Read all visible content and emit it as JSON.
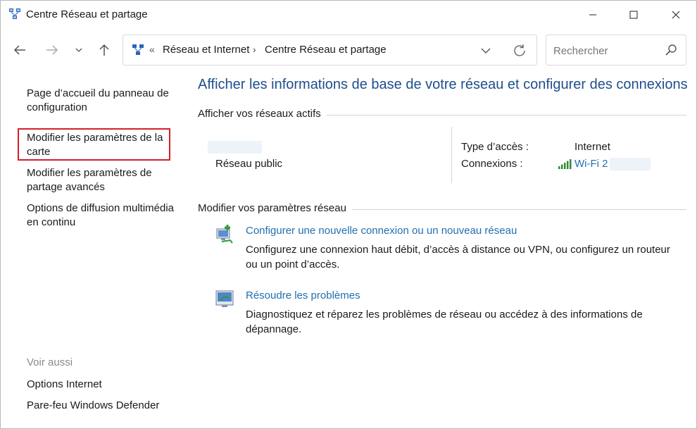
{
  "window": {
    "title": "Centre Réseau et partage"
  },
  "nav": {
    "breadcrumb_prefix": "«",
    "crumbs": [
      "Réseau et Internet",
      "Centre Réseau et partage"
    ],
    "search_placeholder": "Rechercher"
  },
  "sidebar": {
    "links": [
      "Page d’accueil du panneau de configuration",
      "Modifier les paramètres de la carte",
      "Modifier les paramètres de partage avancés",
      "Options de diffusion multimédia en continu"
    ],
    "see_also_heading": "Voir aussi",
    "see_also": [
      "Options Internet",
      "Pare-feu Windows Defender"
    ]
  },
  "main": {
    "title": "Afficher les informations de base de votre réseau et configurer des connexions",
    "active_networks_heading": "Afficher vos réseaux actifs",
    "network_type": "Réseau public",
    "access_type_label": "Type d’accès :",
    "access_type_value": "Internet",
    "connections_label": "Connexions :",
    "connection_name": "Wi-Fi 2",
    "modify_heading": "Modifier vos paramètres réseau",
    "tasks": [
      {
        "link": "Configurer une nouvelle connexion ou un nouveau réseau",
        "description": "Configurez une connexion haut débit, d’accès à distance ou VPN, ou configurez un routeur ou un point d’accès."
      },
      {
        "link": "Résoudre les problèmes",
        "description": "Diagnostiquez et réparez les problèmes de réseau ou accédez à des informations de dépannage."
      }
    ]
  },
  "colors": {
    "link": "#1f6fb0",
    "title": "#1f4e8c",
    "highlight": "#d51f2b"
  }
}
